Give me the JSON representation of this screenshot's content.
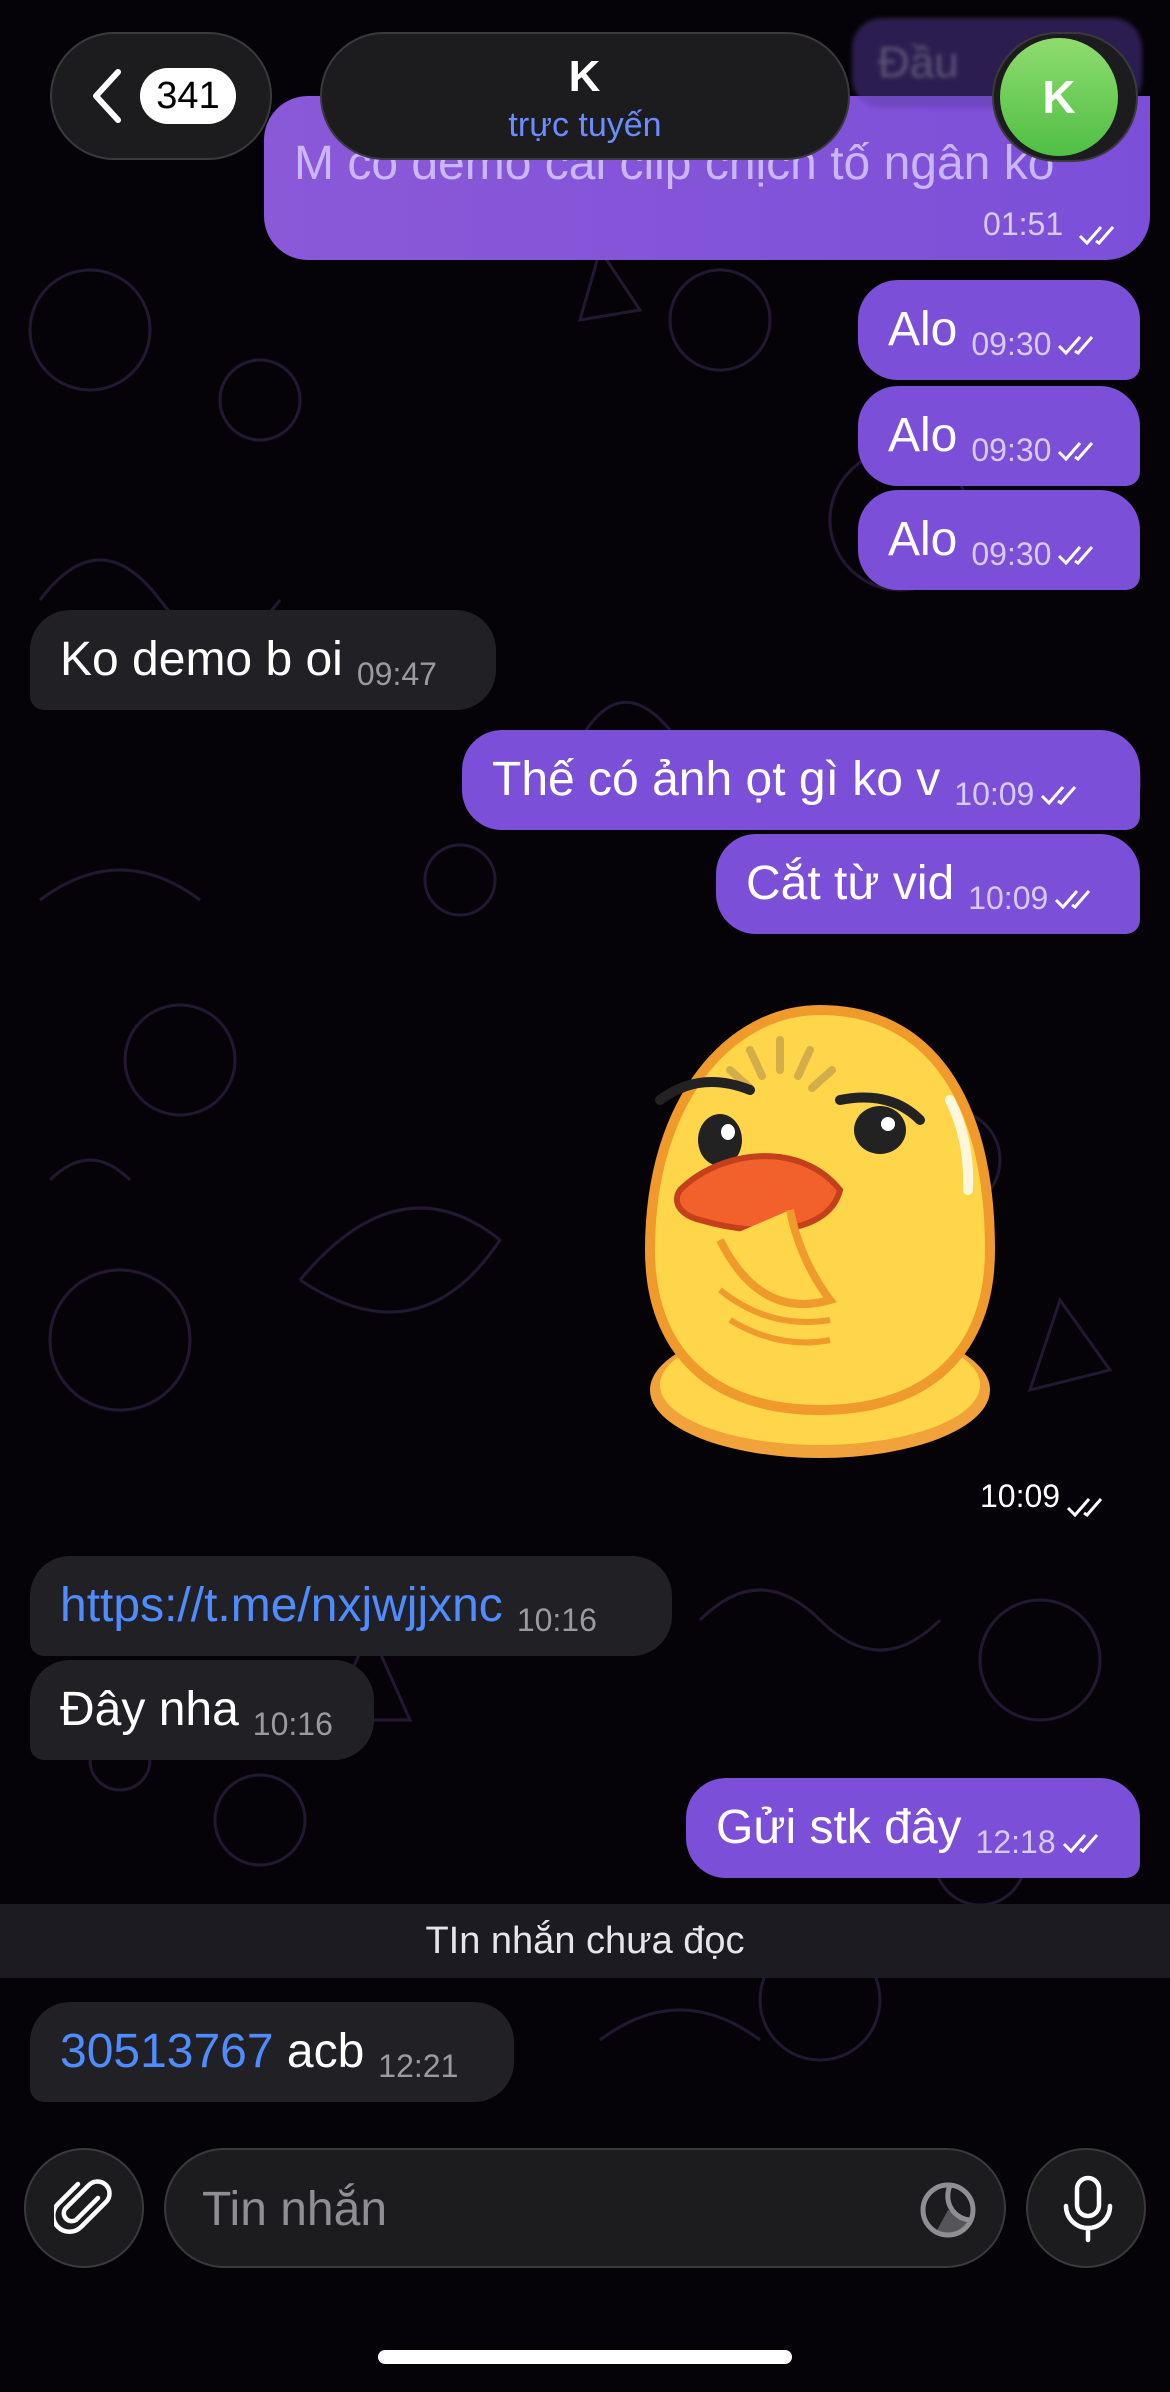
{
  "header": {
    "back_count": "341",
    "chat_name": "K",
    "chat_status": "trực tuyến",
    "ghost_button_label": "Đầu",
    "avatar_initial": "K",
    "avatar_color": "#5cc54c"
  },
  "messages": [
    {
      "direction": "out",
      "text": "M có demo cái clip chịch tố ngân ko",
      "time": "01:51",
      "read": true
    },
    {
      "direction": "out",
      "text": "Alo",
      "time": "09:30",
      "read": true
    },
    {
      "direction": "out",
      "text": "Alo",
      "time": "09:30",
      "read": true
    },
    {
      "direction": "out",
      "text": "Alo",
      "time": "09:30",
      "read": true
    },
    {
      "direction": "in",
      "text": "Ko demo b oi",
      "time": "09:47"
    },
    {
      "direction": "out",
      "text": "Thế có ảnh ọt gì ko v",
      "time": "10:09",
      "read": true
    },
    {
      "direction": "out",
      "text": "Cắt từ vid",
      "time": "10:09",
      "read": true
    },
    {
      "direction": "out",
      "type": "sticker",
      "sticker": "duck-thinking-icon",
      "time": "10:09",
      "read": true
    },
    {
      "direction": "in",
      "link": "https://t.me/nxjwjjxnc",
      "time": "10:16"
    },
    {
      "direction": "in",
      "text": "Đây nha",
      "time": "10:16"
    },
    {
      "direction": "out",
      "text": "Gửi stk đây",
      "time": "12:18",
      "read": true
    },
    {
      "direction": "in",
      "number": "30513767",
      "text": "acb",
      "time": "12:21"
    }
  ],
  "unread_divider": "TIn nhắn chưa đọc",
  "input": {
    "placeholder": "Tin nhắn"
  },
  "colors": {
    "outgoing_bubble": "#7b4fd8",
    "incoming_bubble": "#212024",
    "link": "#4e8cff",
    "status": "#6b8cff"
  }
}
